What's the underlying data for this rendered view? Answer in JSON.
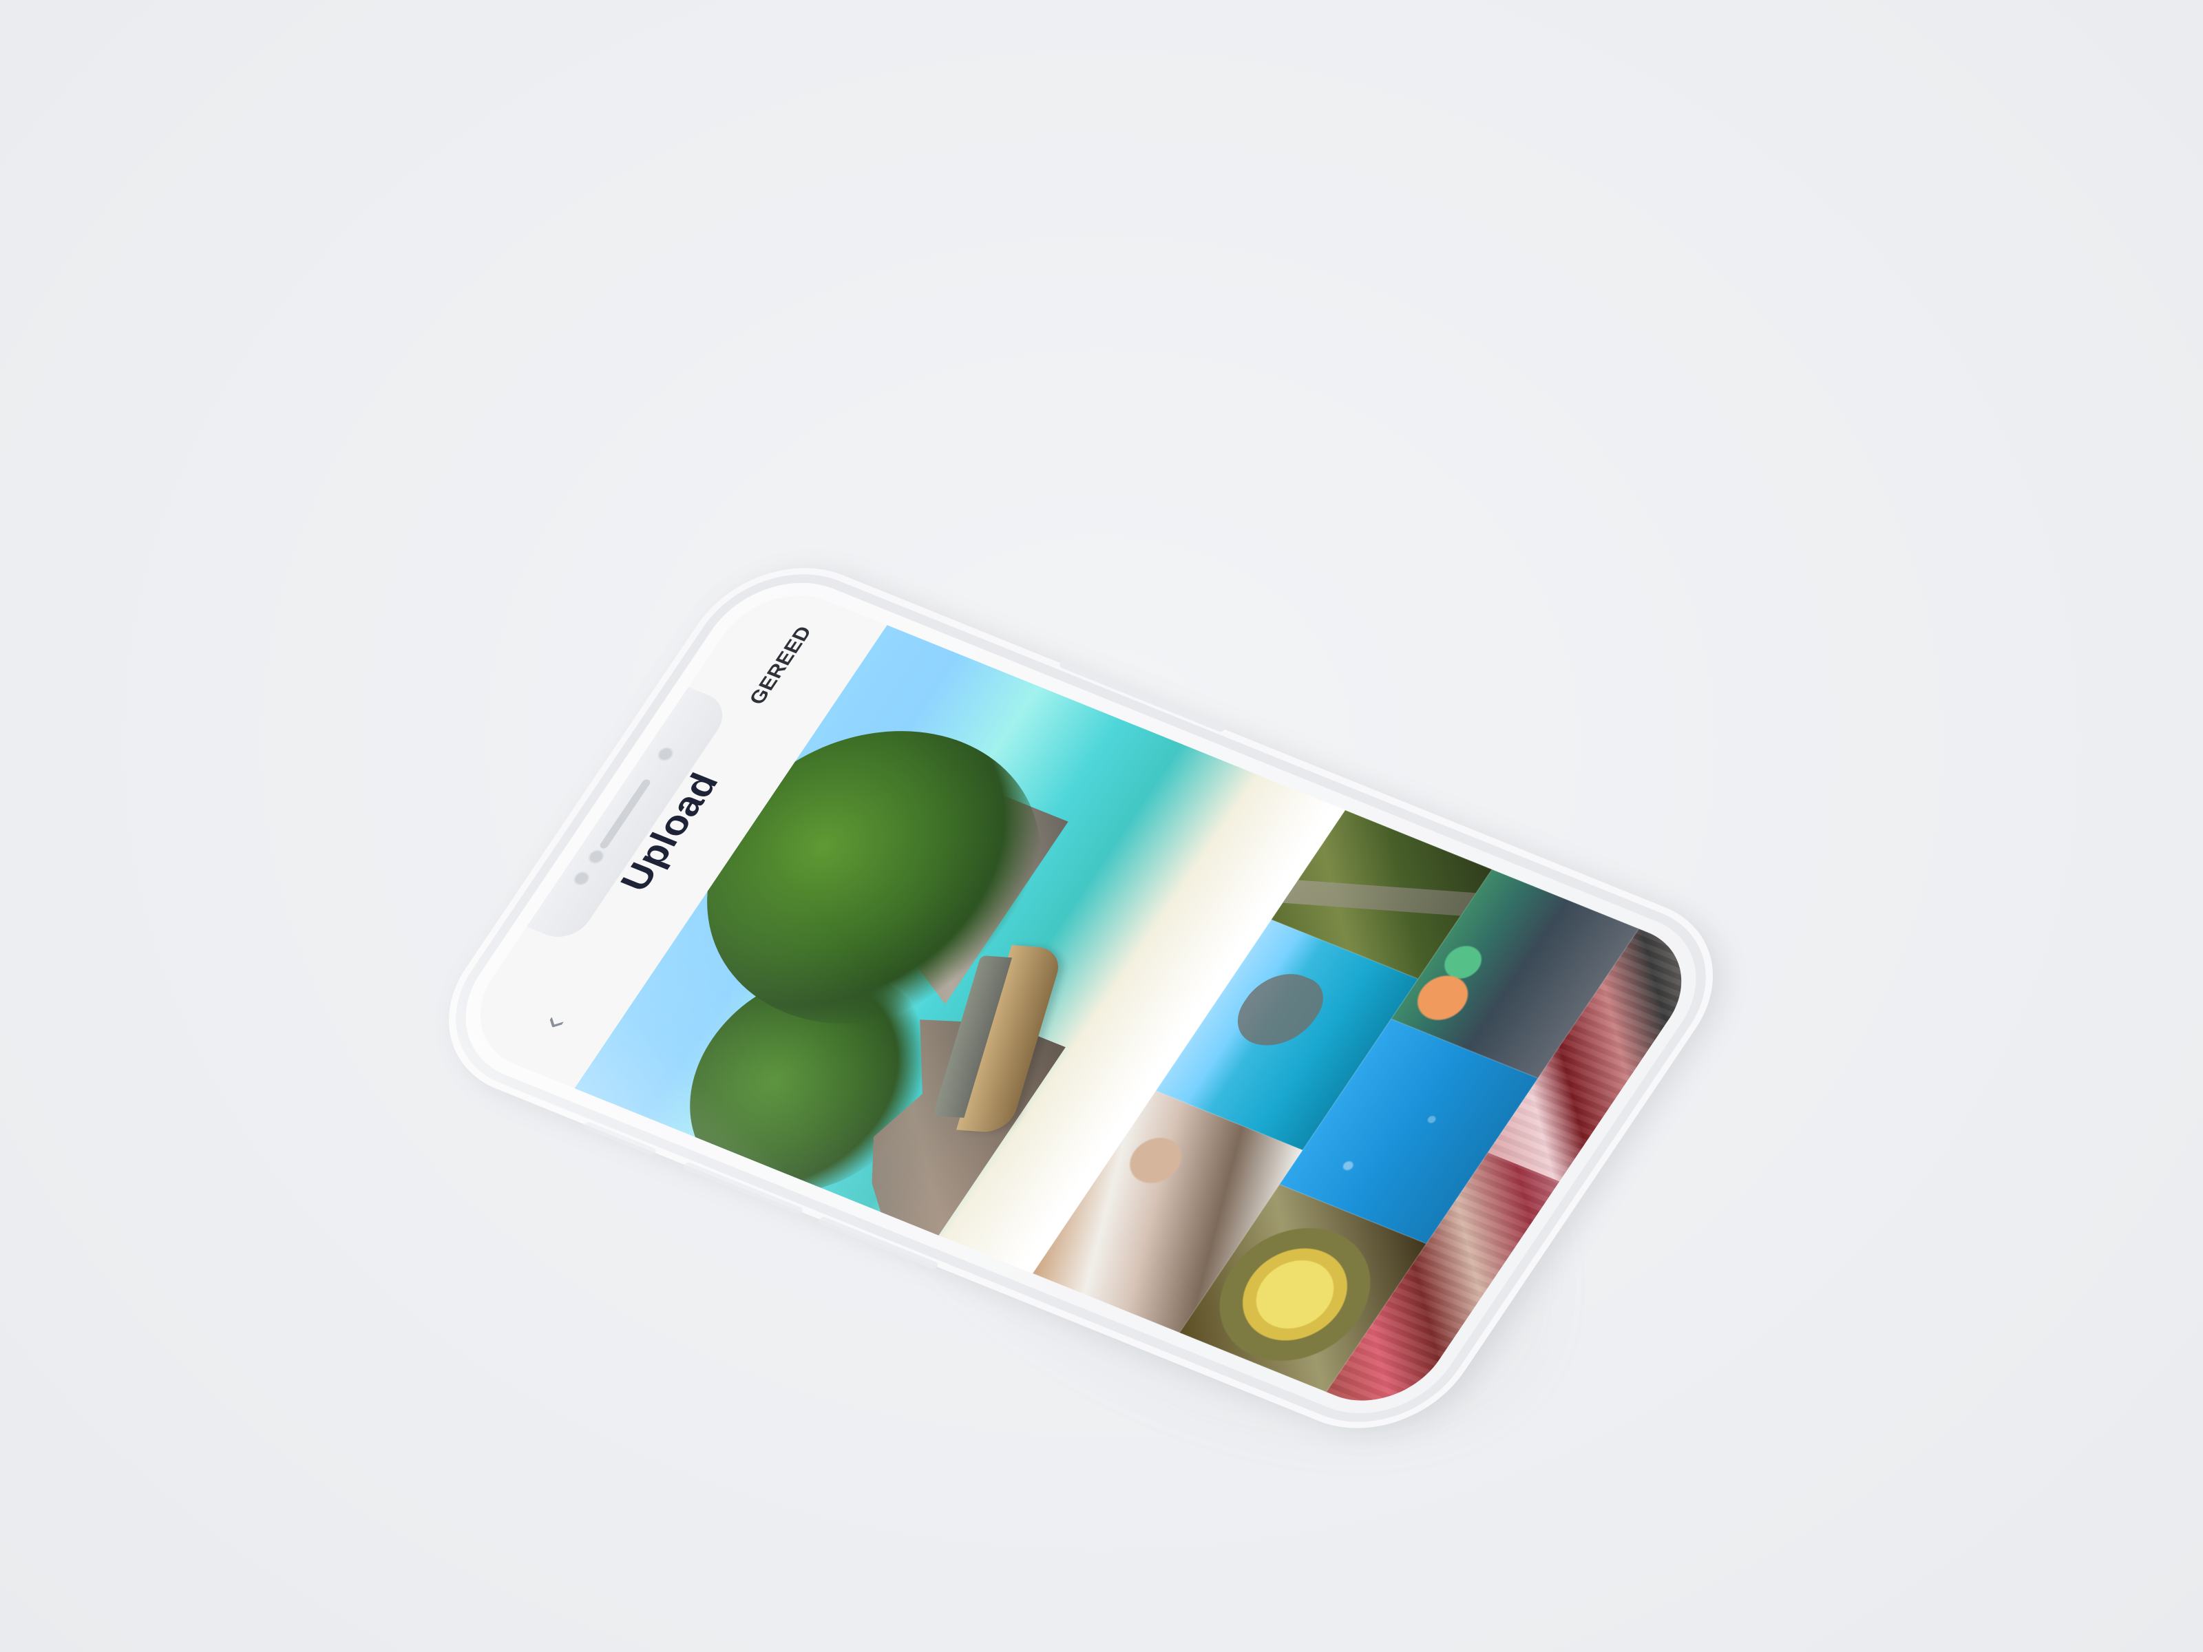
{
  "app": {
    "title": "Upload",
    "done_label": "GEREED"
  },
  "icons": {
    "back": "chevron-left-icon"
  },
  "colors": {
    "background": "#eff0f2",
    "phone": "#f7f7f8",
    "title": "#1f2337",
    "accent_text": "#2e3138"
  },
  "gallery": {
    "hero_name": "beach-photo",
    "tiles": [
      "coastal-town-photo",
      "kayak-photo",
      "forest-road-photo",
      "curry-photo",
      "swimmers-photo",
      "market-photo",
      "temple-detail-photo",
      "temple-interior-photo"
    ]
  }
}
